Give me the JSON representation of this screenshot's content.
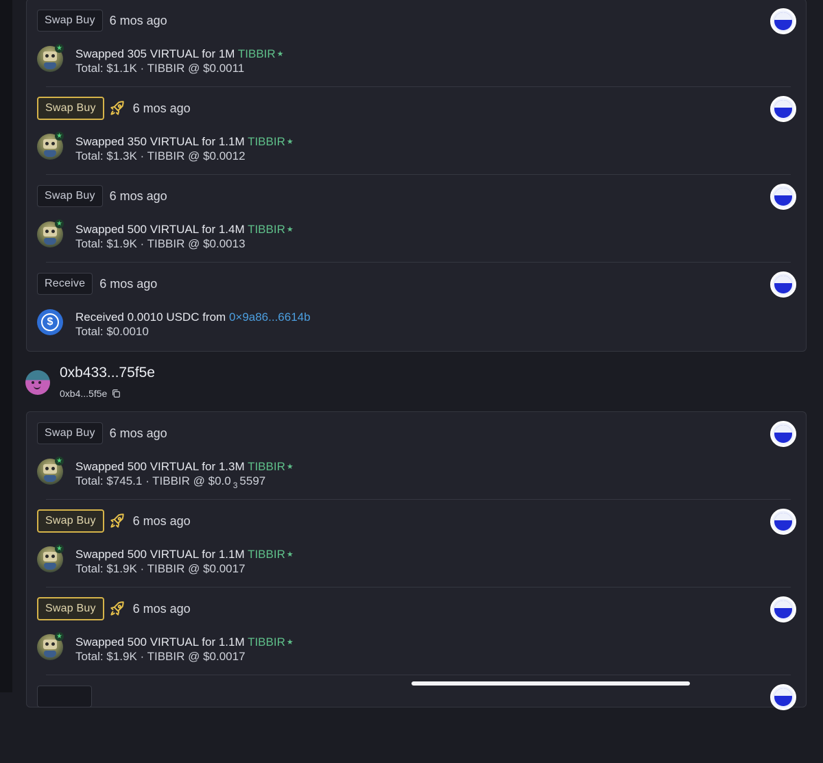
{
  "group1": {
    "rows": [
      {
        "tag": "Swap Buy",
        "highlight": false,
        "time": "6 mos ago",
        "text_pre": "Swapped 305 VIRTUAL for 1M ",
        "token": "TIBBIR",
        "total_line": "Total: $1.1K · TIBBIR @ $0.0011"
      },
      {
        "tag": "Swap Buy",
        "highlight": true,
        "time": "6 mos ago",
        "text_pre": "Swapped 350 VIRTUAL for 1.1M ",
        "token": "TIBBIR",
        "total_line": "Total: $1.3K · TIBBIR @ $0.0012"
      },
      {
        "tag": "Swap Buy",
        "highlight": false,
        "time": "6 mos ago",
        "text_pre": "Swapped 500 VIRTUAL for 1.4M ",
        "token": "TIBBIR",
        "total_line": "Total: $1.9K · TIBBIR @ $0.0013"
      },
      {
        "tag": "Receive",
        "highlight": false,
        "time": "6 mos ago",
        "text_pre": "Received 0.0010 USDC from ",
        "address": "0×9a86...6614b",
        "total_line": "Total: $0.0010"
      }
    ]
  },
  "wallet": {
    "title": "0xb433...75f5e",
    "short": "0xb4...5f5e"
  },
  "group2": {
    "rows": [
      {
        "tag": "Swap Buy",
        "highlight": false,
        "time": "6 mos ago",
        "text_pre": "Swapped 500 VIRTUAL for 1.3M ",
        "token": "TIBBIR",
        "total_pre": "Total: $745.1 · TIBBIR @ $0.0",
        "total_sub": "3",
        "total_post": "5597"
      },
      {
        "tag": "Swap Buy",
        "highlight": true,
        "time": "6 mos ago",
        "text_pre": "Swapped 500 VIRTUAL for 1.1M ",
        "token": "TIBBIR",
        "total_line": "Total: $1.9K · TIBBIR @ $0.0017"
      },
      {
        "tag": "Swap Buy",
        "highlight": true,
        "time": "6 mos ago",
        "text_pre": "Swapped 500 VIRTUAL for 1.1M ",
        "token": "TIBBIR",
        "total_line": "Total: $1.9K · TIBBIR @ $0.0017"
      }
    ]
  },
  "icons": {
    "verified": "★",
    "usdc": "$"
  },
  "colors": {
    "token_green": "#5fc08a",
    "address_blue": "#4c9fe0",
    "highlight_gold": "#d6b44a",
    "chain_blue": "#1f2cd6"
  }
}
